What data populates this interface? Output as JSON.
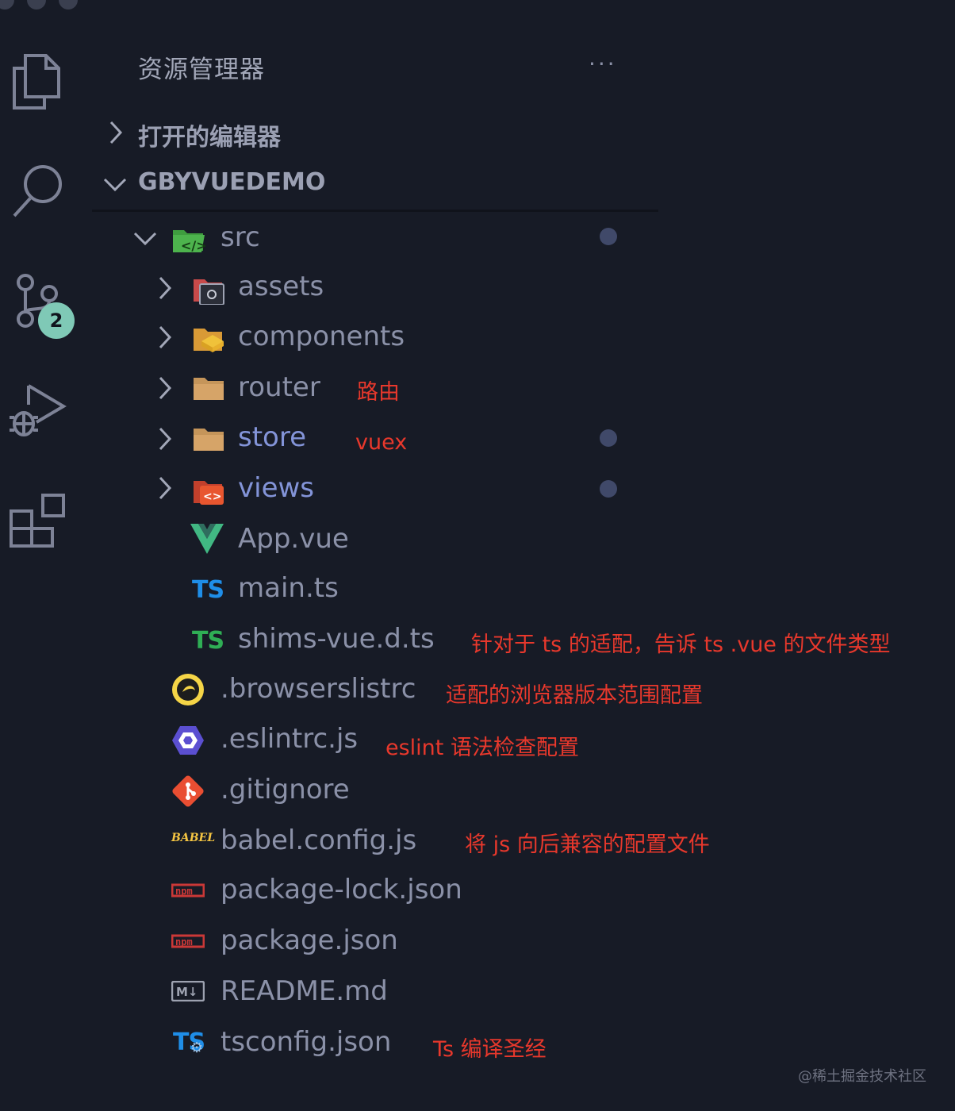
{
  "explorer": {
    "title": "资源管理器",
    "more": "···",
    "open_editors": "打开的编辑器",
    "project": "GBYVUEDEMO"
  },
  "activity_bar": {
    "scm_badge": "2"
  },
  "tree": {
    "src": "src",
    "assets": "assets",
    "components": "components",
    "router": "router",
    "store": "store",
    "views": "views",
    "app_vue": "App.vue",
    "main_ts": "main.ts",
    "shims": "shims-vue.d.ts",
    "browserslistrc": ".browserslistrc",
    "eslintrc": ".eslintrc.js",
    "gitignore": ".gitignore",
    "babel": "babel.config.js",
    "package_lock": "package-lock.json",
    "package": "package.json",
    "readme": "README.md",
    "tsconfig": "tsconfig.json"
  },
  "icon_text": {
    "ts": "TS",
    "babel": "BABEL",
    "npm": "npm",
    "md": "M↓",
    "code": "<>"
  },
  "annotations": {
    "router": "路由",
    "store": "vuex",
    "shims": "针对于 ts 的适配，告诉 ts .vue 的文件类型",
    "browserslistrc": "适配的浏览器版本范围配置",
    "eslintrc": "eslint 语法检查配置",
    "babel": "将 js 向后兼容的配置文件",
    "tsconfig": "Ts 编译圣经"
  },
  "watermark": "@稀土掘金技术社区",
  "colors": {
    "background": "#171b26",
    "annotation": "#e8382c",
    "modified": "#8394d8",
    "badge": "#7fc9b6"
  }
}
